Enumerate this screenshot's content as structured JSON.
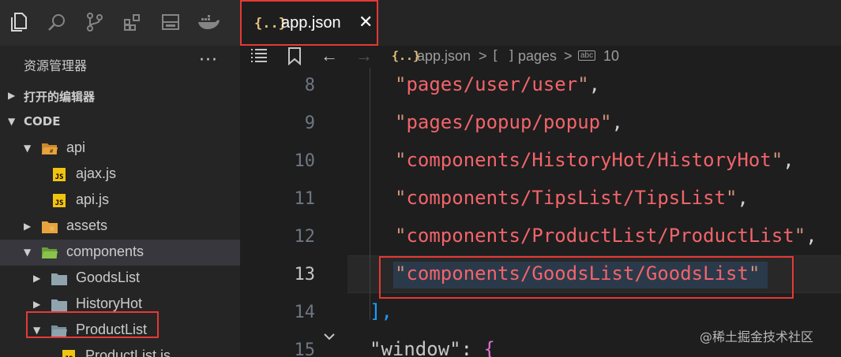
{
  "tabs": [
    {
      "label": "app.json",
      "icon": "json-braces-icon",
      "close": "✕"
    }
  ],
  "tab_icon_text": "{..}",
  "activity_icons": [
    "files-icon",
    "search-icon",
    "source-control-icon",
    "extensions-icon",
    "remote-explorer-icon",
    "docker-icon"
  ],
  "explorer": {
    "title": "资源管理器",
    "more": "···",
    "sections": [
      {
        "label": "打开的编辑器",
        "expanded": false
      },
      {
        "label": "CODE",
        "expanded": true
      }
    ],
    "tree": [
      {
        "label": "api",
        "kind": "folder-open",
        "color": "#e8a33c"
      },
      {
        "label": "ajax.js",
        "kind": "js"
      },
      {
        "label": "api.js",
        "kind": "js"
      },
      {
        "label": "assets",
        "kind": "folder",
        "color": "#e8a33c"
      },
      {
        "label": "components",
        "kind": "folder-open",
        "color": "#8bc34a"
      },
      {
        "label": "GoodsList",
        "kind": "folder",
        "color": "#90a4ae"
      },
      {
        "label": "HistoryHot",
        "kind": "folder",
        "color": "#90a4ae"
      },
      {
        "label": "ProductList",
        "kind": "folder-open",
        "color": "#90a4ae"
      },
      {
        "label": "ProductList.js",
        "kind": "js"
      }
    ],
    "js_badge": "JS"
  },
  "breadcrumb": {
    "file_icon": "{..}",
    "file": "app.json",
    "sep1": ">",
    "array_icon": "[ ]",
    "pages": "pages",
    "sep2": ">",
    "item_icon": "abc",
    "item": "10"
  },
  "editor": {
    "lines": [
      {
        "num": "8",
        "text": "pages/user/user",
        "comma": ","
      },
      {
        "num": "9",
        "text": "pages/popup/popup",
        "comma": ","
      },
      {
        "num": "10",
        "text": "components/HistoryHot/HistoryHot",
        "comma": ","
      },
      {
        "num": "11",
        "text": "components/TipsList/TipsList",
        "comma": ","
      },
      {
        "num": "12",
        "text": "components/ProductList/ProductList",
        "comma": ","
      },
      {
        "num": "13",
        "text": "components/GoodsList/GoodsList",
        "comma": ""
      },
      {
        "num": "14",
        "close": "],"
      },
      {
        "num": "15",
        "key": "window",
        "colon": ": ",
        "brace": "{"
      }
    ],
    "active_line": "13",
    "quote": "\""
  },
  "colors": {
    "highlight_box": "#e53935",
    "string": "#f2646b",
    "quote": "#ce9178"
  },
  "watermark": "@稀土掘金技术社区"
}
